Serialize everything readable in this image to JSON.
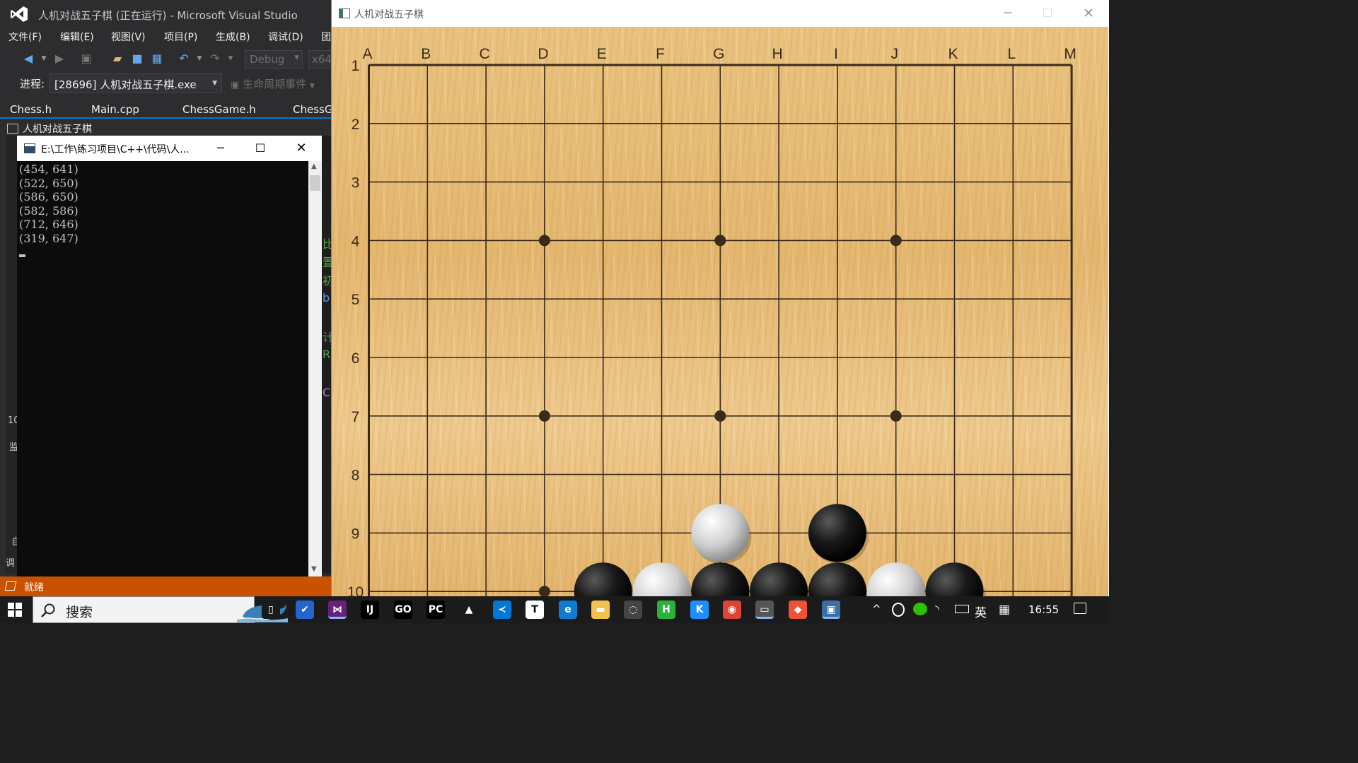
{
  "vs": {
    "title": "人机对战五子棋 (正在运行) - Microsoft Visual Studio",
    "menu": [
      "文件(F)",
      "编辑(E)",
      "视图(V)",
      "项目(P)",
      "生成(B)",
      "调试(D)",
      "团"
    ],
    "toolbar": {
      "config": "Debug",
      "platform": "x64"
    },
    "process_label": "进程:",
    "process_value": "[28696] 人机对战五子棋.exe",
    "lifecycle_label": "生命周期事件",
    "tabs": [
      "Chess.h",
      "Main.cpp",
      "ChessGame.h",
      "ChessGa"
    ],
    "subwindow_title": "人机对战五子棋",
    "side_fragments": [
      "10",
      "监",
      "自",
      "调"
    ],
    "code_fragments": [
      "比",
      "置",
      "初",
      "b",
      "计",
      "R",
      "C"
    ],
    "status": "就绪"
  },
  "console": {
    "title": "E:\\工作\\练习项目\\C++\\代码\\人...",
    "lines": [
      "(454, 641)",
      "(522, 650)",
      "(586, 650)",
      "(582, 586)",
      "(712, 646)",
      "(319, 647)"
    ]
  },
  "game": {
    "title": "人机对战五子棋",
    "columns": [
      "A",
      "B",
      "C",
      "D",
      "E",
      "F",
      "G",
      "H",
      "I",
      "J",
      "K",
      "L",
      "M"
    ],
    "rows": [
      "1",
      "2",
      "3",
      "4",
      "5",
      "6",
      "7",
      "8",
      "9",
      "10"
    ],
    "star_points": [
      {
        "col": "D",
        "row": 4
      },
      {
        "col": "G",
        "row": 4
      },
      {
        "col": "J",
        "row": 4
      },
      {
        "col": "D",
        "row": 7
      },
      {
        "col": "G",
        "row": 7
      },
      {
        "col": "J",
        "row": 7
      },
      {
        "col": "D",
        "row": 10
      }
    ],
    "stones": [
      {
        "col": "G",
        "row": 9,
        "color": "white"
      },
      {
        "col": "I",
        "row": 9,
        "color": "black"
      },
      {
        "col": "E",
        "row": 10,
        "color": "black"
      },
      {
        "col": "F",
        "row": 10,
        "color": "white"
      },
      {
        "col": "G",
        "row": 10,
        "color": "black"
      },
      {
        "col": "H",
        "row": 10,
        "color": "black"
      },
      {
        "col": "I",
        "row": 10,
        "color": "black"
      },
      {
        "col": "J",
        "row": 10,
        "color": "white"
      },
      {
        "col": "K",
        "row": 10,
        "color": "black"
      }
    ]
  },
  "taskbar": {
    "search_text": "搜索",
    "apps": [
      "task-view-icon",
      "todo-icon",
      "visual-studio-icon",
      "jetbrains-icon",
      "goland-icon",
      "pycharm-icon",
      "matlab-icon",
      "vscode-icon",
      "typora-icon",
      "edge-icon",
      "file-explorer-icon",
      "wechat-dev-icon",
      "hbuilder-icon",
      "kugou-icon",
      "chrome-icon",
      "console-app-icon",
      "git-icon",
      "game-app-icon"
    ],
    "ime": "英",
    "time": "16:55"
  },
  "colors": {
    "accent": "#007acc",
    "status_bar": "#ca5100",
    "board": "#e6b972"
  }
}
